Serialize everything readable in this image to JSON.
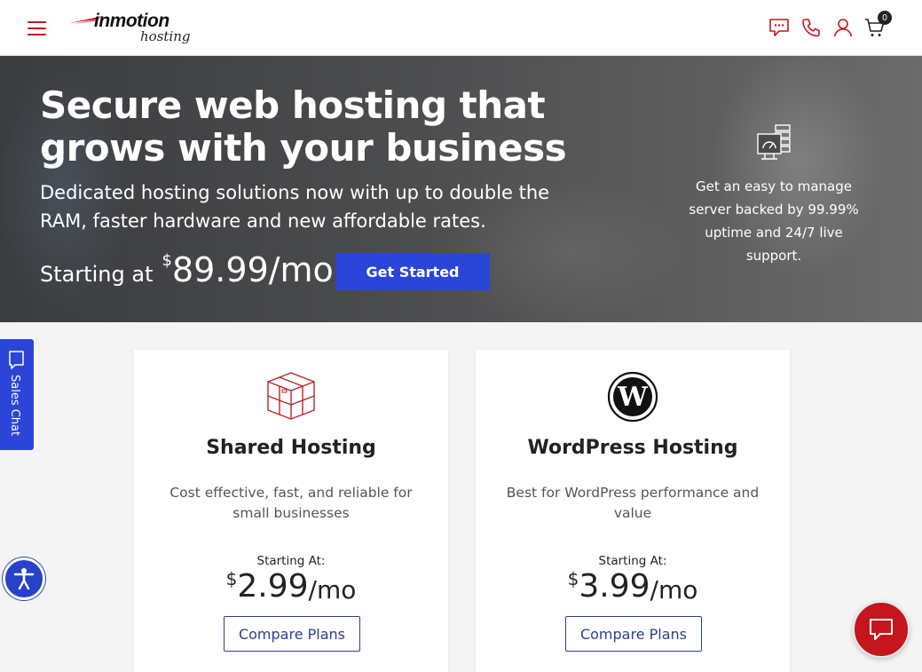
{
  "header": {
    "logo_brand": "inmotion",
    "logo_sub": "hosting",
    "cart_count": "0",
    "icons": [
      "menu-icon",
      "chat-icon",
      "phone-icon",
      "user-icon",
      "cart-icon"
    ]
  },
  "hero": {
    "title": "Secure web hosting that grows with your business",
    "subtitle": "Dedicated hosting solutions now with up to double the RAM, faster hardware and new affordable rates.",
    "starting_label": "Starting at",
    "currency": "$",
    "price": "89.99/mo",
    "cta_label": "Get Started",
    "side_text": "Get an easy to manage server backed by 99.99% uptime and 24/7 live support."
  },
  "cards": [
    {
      "title": "Shared Hosting",
      "description": "Cost effective, fast, and reliable for small businesses",
      "starting_label": "Starting At:",
      "currency": "$",
      "price": "2.99",
      "period": "/mo",
      "button_label": "Compare Plans",
      "icon": "box-icon"
    },
    {
      "title": "WordPress Hosting",
      "description": "Best for WordPress performance and value",
      "starting_label": "Starting At:",
      "currency": "$",
      "price": "3.99",
      "period": "/mo",
      "button_label": "Compare Plans",
      "icon": "wordpress-icon"
    }
  ],
  "sales_chat": {
    "label": "Sales Chat"
  },
  "colors": {
    "brand_red": "#c4161c",
    "accent_blue": "#2b45d9",
    "outline_blue": "#2b3f8c"
  }
}
